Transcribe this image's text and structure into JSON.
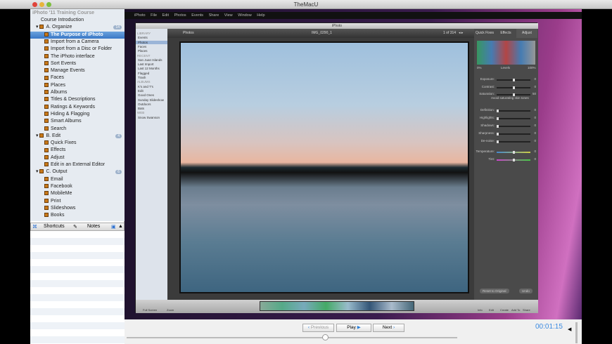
{
  "window": {
    "title": "TheMacU"
  },
  "sidebar": {
    "course_title": "iPhoto '11 Training Course",
    "items": [
      {
        "label": "Course Introduction",
        "level": 0
      },
      {
        "label": "A. Organize",
        "level": 1,
        "badge": "14"
      },
      {
        "label": "The Purpose of iPhoto",
        "level": 2,
        "selected": true
      },
      {
        "label": "Import from a Camera",
        "level": 2
      },
      {
        "label": "Import from a Disc or Folder",
        "level": 2
      },
      {
        "label": "The iPhoto interface",
        "level": 2
      },
      {
        "label": "Sort Events",
        "level": 2
      },
      {
        "label": "Manage Events",
        "level": 2
      },
      {
        "label": "Faces",
        "level": 2
      },
      {
        "label": "Places",
        "level": 2
      },
      {
        "label": "Albums",
        "level": 2
      },
      {
        "label": "Titles & Descriptions",
        "level": 2
      },
      {
        "label": "Ratings & Keywords",
        "level": 2
      },
      {
        "label": "Hiding & Flagging",
        "level": 2
      },
      {
        "label": "Smart Albums",
        "level": 2
      },
      {
        "label": "Search",
        "level": 2
      },
      {
        "label": "B. Edit",
        "level": 1,
        "badge": "4"
      },
      {
        "label": "Quick Fixes",
        "level": 2
      },
      {
        "label": "Effects",
        "level": 2
      },
      {
        "label": "Adjust",
        "level": 2
      },
      {
        "label": "Edit in an External Editor",
        "level": 2
      },
      {
        "label": "C. Output",
        "level": 1,
        "badge": "6"
      },
      {
        "label": "Email",
        "level": 2
      },
      {
        "label": "Facebook",
        "level": 2
      },
      {
        "label": "MobileMe",
        "level": 2
      },
      {
        "label": "Print",
        "level": 2
      },
      {
        "label": "Slideshows",
        "level": 2
      },
      {
        "label": "Books",
        "level": 2
      }
    ],
    "tabs": {
      "shortcuts": "Shortcuts",
      "notes": "Notes"
    }
  },
  "iphoto": {
    "menus": [
      "iPhoto",
      "File",
      "Edit",
      "Photos",
      "Events",
      "Share",
      "View",
      "Window",
      "Help"
    ],
    "window_title": "iPhoto",
    "source": [
      {
        "label": "LIBRARY",
        "header": true
      },
      {
        "label": "Events"
      },
      {
        "label": "Photos",
        "selected": true
      },
      {
        "label": "Faces"
      },
      {
        "label": "Places"
      },
      {
        "label": "RECENT",
        "header": true
      },
      {
        "label": "San Juan Islands"
      },
      {
        "label": "Last Import"
      },
      {
        "label": "Last 12 Months"
      },
      {
        "label": "Flagged"
      },
      {
        "label": "Trash"
      },
      {
        "label": "ALBUMS",
        "header": true
      },
      {
        "label": "K's and T's"
      },
      {
        "label": "Edit"
      },
      {
        "label": "Good Ones"
      },
      {
        "label": "Sunday Slideshow"
      },
      {
        "label": "Outdoors"
      },
      {
        "label": "Bats"
      },
      {
        "label": "WEB",
        "header": true
      },
      {
        "label": "Snow Swanson"
      }
    ],
    "view_title": "Photos",
    "photo_name": "IMG_0290_1",
    "counter": "1 of 314",
    "panel_tabs": [
      "Quick Fixes",
      "Effects",
      "Adjust"
    ],
    "levels": {
      "left": "0%",
      "center": "Levels",
      "right": "100%"
    },
    "sliders": [
      {
        "label": "Exposure:",
        "value": "0",
        "level": 0.5
      },
      {
        "label": "Contrast:",
        "value": "0",
        "level": 0.5
      },
      {
        "label": "Saturation:",
        "value": "50",
        "level": 0.5
      },
      {
        "label": "Definition:",
        "value": "0",
        "level": 0
      },
      {
        "label": "Highlights:",
        "value": "0",
        "level": 0
      },
      {
        "label": "Shadows:",
        "value": "0",
        "level": 0
      },
      {
        "label": "Sharpness:",
        "value": "0",
        "level": 0
      },
      {
        "label": "De-noise:",
        "value": "0",
        "level": 0
      },
      {
        "label": "Temperature:",
        "value": "0",
        "level": 0.5
      },
      {
        "label": "Tint:",
        "value": "0",
        "level": 0.5
      }
    ],
    "avoid_skin": "Avoid saturating skin tones",
    "reset": "Reset to Original",
    "undo": "Undo",
    "bottom": {
      "fullscreen": "Full Screen",
      "zoom": "Zoom",
      "tools": [
        "Info",
        "Edit",
        "Create",
        "Add To",
        "Share"
      ]
    }
  },
  "player": {
    "previous": "Previous",
    "play": "Play",
    "next": "Next",
    "time": "00:01:15",
    "progress": 0.6
  }
}
